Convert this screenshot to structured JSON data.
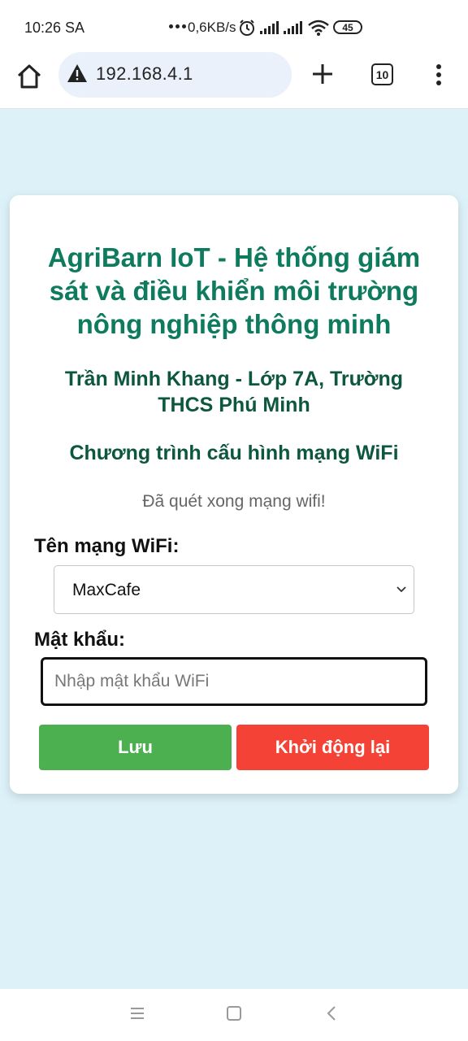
{
  "status_bar": {
    "time": "10:26 SA",
    "network_speed": "0,6KB/s",
    "battery": "45",
    "icons": [
      "more-dots-icon",
      "alarm-icon",
      "signal-icon",
      "signal-icon",
      "wifi-icon",
      "battery-icon"
    ]
  },
  "browser": {
    "url": "192.168.4.1",
    "tab_count": "10",
    "icons": [
      "home-icon",
      "warning-icon",
      "plus-icon",
      "tabs-icon",
      "more-vert-icon"
    ]
  },
  "page": {
    "title": "AgriBarn IoT - Hệ thống giám sát và điều khiển môi trường nông nghiệp thông minh",
    "author": "Trần Minh Khang - Lớp 7A, Trường THCS Phú Minh",
    "subtitle": "Chương trình cấu hình mạng WiFi",
    "status_message": "Đã quét xong mạng wifi!",
    "ssid_label": "Tên mạng WiFi:",
    "ssid_selected": "MaxCafe",
    "password_label": "Mật khẩu:",
    "password_placeholder": "Nhập mật khẩu WiFi",
    "password_value": "",
    "save_button": "Lưu",
    "reboot_button": "Khởi động lại"
  },
  "colors": {
    "background": "#dcf2f8",
    "title": "#0f7b5e",
    "heading": "#0d5640",
    "save": "#4caf50",
    "reboot": "#f44336"
  }
}
